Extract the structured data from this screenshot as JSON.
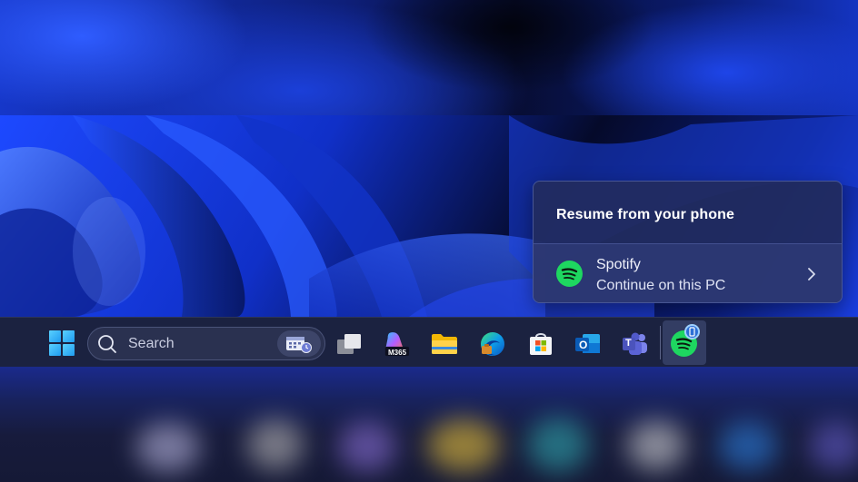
{
  "flyout": {
    "title": "Resume from your phone",
    "item": {
      "app_name": "Spotify",
      "action": "Continue on this PC",
      "icon": "spotify-icon"
    }
  },
  "taskbar": {
    "search": {
      "label": "Search"
    },
    "apps": [
      {
        "name": "task-view-icon"
      },
      {
        "name": "m365-copilot-icon",
        "badge_text": "M365"
      },
      {
        "name": "file-explorer-icon"
      },
      {
        "name": "edge-icon"
      },
      {
        "name": "microsoft-store-icon"
      },
      {
        "name": "outlook-icon",
        "letter": "O"
      },
      {
        "name": "teams-icon",
        "letter": "T"
      },
      {
        "name": "spotify-phone-icon"
      }
    ]
  },
  "colors": {
    "spotify_green": "#1ed760",
    "windows_blue": "#3bb4f8",
    "taskbar_bg": "#1b2240"
  }
}
